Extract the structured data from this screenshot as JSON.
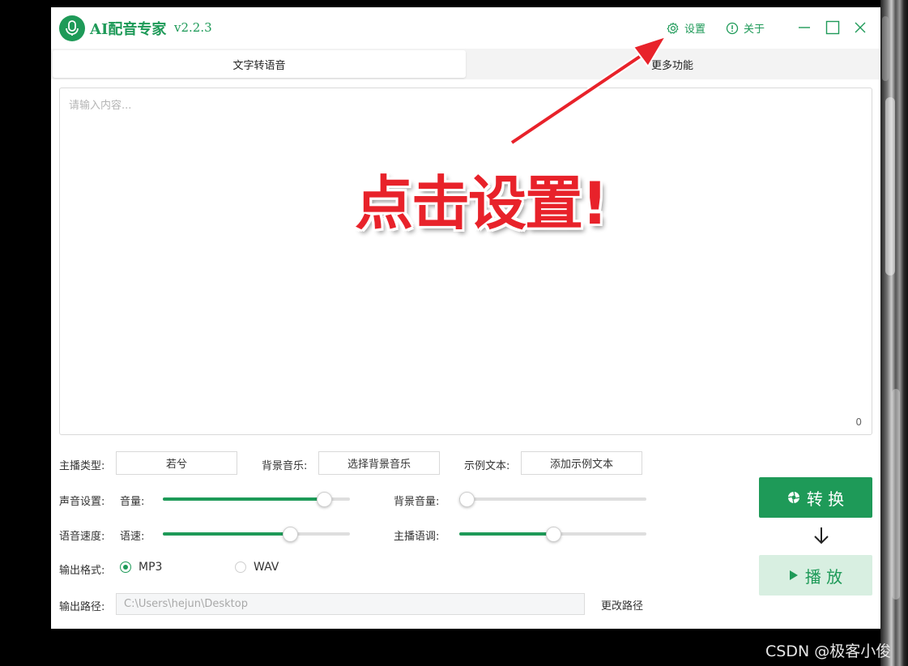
{
  "app": {
    "name": "AI配音专家",
    "version": "v2.2.3"
  },
  "titlebar": {
    "settings_label": "设置",
    "about_label": "关于"
  },
  "tabs": [
    {
      "label": "文字转语音"
    },
    {
      "label": "更多功能"
    }
  ],
  "editor": {
    "placeholder": "请输入内容...",
    "char_count": "0"
  },
  "anchor": {
    "label": "主播类型:",
    "value": "若兮"
  },
  "bgm": {
    "label": "背景音乐:",
    "button": "选择背景音乐"
  },
  "sample": {
    "label": "示例文本:",
    "button": "添加示例文本"
  },
  "sound": {
    "label": "声音设置:",
    "volume_label": "音量:",
    "volume_value": 0.86,
    "bg_volume_label": "背景音量:",
    "bg_volume_value": 0.04
  },
  "speed": {
    "label": "语音速度:",
    "speed_label": "语速:",
    "speed_value": 0.68,
    "pitch_label": "主播语调:",
    "pitch_value": 0.5
  },
  "output_format": {
    "label": "输出格式:",
    "options": [
      "MP3",
      "WAV"
    ],
    "selected": "MP3"
  },
  "output_path": {
    "label": "输出路径:",
    "value": "C:\\Users\\hejun\\Desktop",
    "change_label": "更改路径"
  },
  "actions": {
    "convert_label": "转 换",
    "play_label": "播 放"
  },
  "annotation": {
    "text": "点击设置!"
  },
  "watermark": "CSDN @极客小俊",
  "colors": {
    "accent": "#1e9a58",
    "accent_light": "#d8efe1",
    "annotation_red": "#e8222a"
  }
}
